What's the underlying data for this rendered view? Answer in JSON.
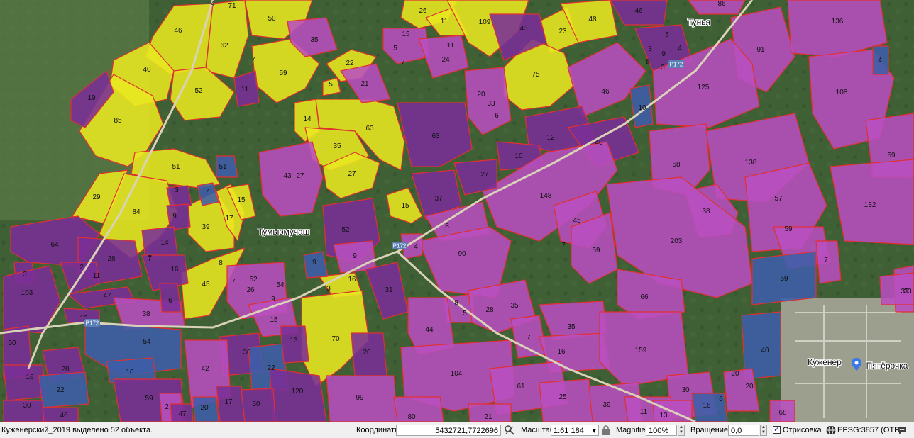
{
  "map": {
    "colors": {
      "background": "#3f5f35",
      "field_yellow": "#e8e820",
      "field_magenta": "#b84fc0",
      "field_purple": "#7a2f96",
      "field_blue": "#3d5fa8",
      "field_outline": "#e03030",
      "road": "#d9d2b8",
      "label": "#111111"
    },
    "place_labels": [
      {
        "id": "tunya",
        "text": "Тунья"
      },
      {
        "id": "tumyumuchash",
        "text": "Тумьюмучаш"
      },
      {
        "id": "kuzhener",
        "text": "Куженер"
      },
      {
        "id": "pyaterochka",
        "text": "Пятёрочка"
      }
    ],
    "road_labels": [
      {
        "id": "r172a",
        "text": "Р172"
      },
      {
        "id": "r172b",
        "text": "Р172"
      },
      {
        "id": "r172c",
        "text": "Р172"
      }
    ],
    "field_labels": [
      {
        "id": "y46",
        "text": "46",
        "color": "yellow"
      },
      {
        "id": "y71",
        "text": "71",
        "color": "yellow"
      },
      {
        "id": "y4a",
        "text": "4",
        "color": "yellow"
      },
      {
        "id": "y50",
        "text": "50",
        "color": "yellow"
      },
      {
        "id": "y62",
        "text": "62",
        "color": "yellow"
      },
      {
        "id": "y40",
        "text": "40",
        "color": "yellow"
      },
      {
        "id": "y52",
        "text": "52",
        "color": "yellow"
      },
      {
        "id": "y59a",
        "text": "59",
        "color": "yellow"
      },
      {
        "id": "y7a",
        "text": "7",
        "color": "yellow"
      },
      {
        "id": "y85",
        "text": "85",
        "color": "yellow"
      },
      {
        "id": "y51a",
        "text": "51",
        "color": "yellow"
      },
      {
        "id": "y29",
        "text": "29",
        "color": "yellow"
      },
      {
        "id": "y84",
        "text": "84",
        "color": "yellow"
      },
      {
        "id": "y39",
        "text": "39",
        "color": "yellow"
      },
      {
        "id": "y17",
        "text": "17",
        "color": "yellow"
      },
      {
        "id": "y15a",
        "text": "15",
        "color": "yellow"
      },
      {
        "id": "y45",
        "text": "45",
        "color": "yellow"
      },
      {
        "id": "y22a",
        "text": "22",
        "color": "yellow"
      },
      {
        "id": "y5a",
        "text": "5",
        "color": "yellow"
      },
      {
        "id": "y14a",
        "text": "14",
        "color": "yellow"
      },
      {
        "id": "y63a",
        "text": "63",
        "color": "yellow"
      },
      {
        "id": "y35a",
        "text": "35",
        "color": "yellow"
      },
      {
        "id": "y27a",
        "text": "27",
        "color": "yellow"
      },
      {
        "id": "y15b",
        "text": "15",
        "color": "yellow"
      },
      {
        "id": "y16a",
        "text": "16",
        "color": "yellow"
      },
      {
        "id": "y70",
        "text": "70",
        "color": "yellow"
      },
      {
        "id": "y3a",
        "text": "3",
        "color": "yellow"
      },
      {
        "id": "y26a",
        "text": "26",
        "color": "yellow"
      },
      {
        "id": "y11a",
        "text": "11",
        "color": "yellow"
      },
      {
        "id": "y109",
        "text": "109",
        "color": "yellow"
      },
      {
        "id": "y23",
        "text": "23",
        "color": "yellow"
      },
      {
        "id": "y48",
        "text": "48",
        "color": "yellow"
      },
      {
        "id": "y75",
        "text": "75",
        "color": "yellow"
      },
      {
        "id": "p35a",
        "text": "35",
        "color": "magenta"
      },
      {
        "id": "p11a",
        "text": "11",
        "color": "purple"
      },
      {
        "id": "p19",
        "text": "19",
        "color": "purple"
      },
      {
        "id": "p21",
        "text": "21",
        "color": "magenta"
      },
      {
        "id": "p15c",
        "text": "15",
        "color": "magenta"
      },
      {
        "id": "p5b",
        "text": "5",
        "color": "magenta"
      },
      {
        "id": "p7b",
        "text": "7",
        "color": "magenta"
      },
      {
        "id": "p11b",
        "text": "11",
        "color": "magenta"
      },
      {
        "id": "p24",
        "text": "24",
        "color": "magenta"
      },
      {
        "id": "p43a",
        "text": "43",
        "color": "purple"
      },
      {
        "id": "p20a",
        "text": "20",
        "color": "magenta"
      },
      {
        "id": "p33a",
        "text": "33",
        "color": "magenta"
      },
      {
        "id": "p6a",
        "text": "6",
        "color": "magenta"
      },
      {
        "id": "p63b",
        "text": "63",
        "color": "purple"
      },
      {
        "id": "p46a",
        "text": "46",
        "color": "purple"
      },
      {
        "id": "p46b",
        "text": "46",
        "color": "magenta"
      },
      {
        "id": "p86",
        "text": "86",
        "color": "magenta"
      },
      {
        "id": "p5c",
        "text": "5",
        "color": "purple"
      },
      {
        "id": "p3b",
        "text": "3",
        "color": "purple"
      },
      {
        "id": "p9a",
        "text": "9",
        "color": "purple"
      },
      {
        "id": "p4b",
        "text": "4",
        "color": "purple"
      },
      {
        "id": "p8a",
        "text": "8",
        "color": "purple"
      },
      {
        "id": "p3c",
        "text": "3",
        "color": "purple"
      },
      {
        "id": "p91",
        "text": "91",
        "color": "magenta"
      },
      {
        "id": "p136",
        "text": "136",
        "color": "magenta"
      },
      {
        "id": "p125",
        "text": "125",
        "color": "magenta"
      },
      {
        "id": "p108",
        "text": "108",
        "color": "magenta"
      },
      {
        "id": "b4a",
        "text": "4",
        "color": "blue"
      },
      {
        "id": "b10a",
        "text": "10",
        "color": "blue"
      },
      {
        "id": "p12",
        "text": "12",
        "color": "purple"
      },
      {
        "id": "p10b",
        "text": "10",
        "color": "purple"
      },
      {
        "id": "p40a",
        "text": "40",
        "color": "purple"
      },
      {
        "id": "p58",
        "text": "58",
        "color": "magenta"
      },
      {
        "id": "p138",
        "text": "138",
        "color": "magenta"
      },
      {
        "id": "p59b",
        "text": "59",
        "color": "magenta"
      },
      {
        "id": "p148",
        "text": "148",
        "color": "magenta"
      },
      {
        "id": "p57",
        "text": "57",
        "color": "magenta"
      },
      {
        "id": "p38a",
        "text": "38",
        "color": "magenta"
      },
      {
        "id": "p132",
        "text": "132",
        "color": "magenta"
      },
      {
        "id": "p59c",
        "text": "59",
        "color": "magenta"
      },
      {
        "id": "p203",
        "text": "203",
        "color": "magenta"
      },
      {
        "id": "p45b",
        "text": "45",
        "color": "magenta"
      },
      {
        "id": "p7c",
        "text": "7",
        "color": "magenta"
      },
      {
        "id": "p59d",
        "text": "59",
        "color": "magenta"
      },
      {
        "id": "b59e",
        "text": "59",
        "color": "blue"
      },
      {
        "id": "p7d",
        "text": "7",
        "color": "magenta"
      },
      {
        "id": "p33b",
        "text": "33",
        "color": "magenta"
      },
      {
        "id": "p43b",
        "text": "43",
        "color": "magenta"
      },
      {
        "id": "p27b",
        "text": "27",
        "color": "magenta"
      },
      {
        "id": "b51b",
        "text": "51",
        "color": "blue"
      },
      {
        "id": "b7e",
        "text": "7",
        "color": "blue"
      },
      {
        "id": "p3d",
        "text": "3",
        "color": "purple"
      },
      {
        "id": "p9b",
        "text": "9",
        "color": "purple"
      },
      {
        "id": "p14b",
        "text": "14",
        "color": "purple"
      },
      {
        "id": "p7f",
        "text": "7",
        "color": "purple"
      },
      {
        "id": "p37",
        "text": "37",
        "color": "purple"
      },
      {
        "id": "p27c",
        "text": "27",
        "color": "purple"
      },
      {
        "id": "p8b",
        "text": "8",
        "color": "magenta"
      },
      {
        "id": "p52b",
        "text": "52",
        "color": "purple"
      },
      {
        "id": "p90",
        "text": "90",
        "color": "magenta"
      },
      {
        "id": "p4c",
        "text": "4",
        "color": "magenta"
      },
      {
        "id": "p64",
        "text": "64",
        "color": "purple"
      },
      {
        "id": "p28a",
        "text": "28",
        "color": "purple"
      },
      {
        "id": "p3e",
        "text": "3",
        "color": "purple"
      },
      {
        "id": "p103",
        "text": "103",
        "color": "purple"
      },
      {
        "id": "p2a",
        "text": "2",
        "color": "purple"
      },
      {
        "id": "p11c",
        "text": "11",
        "color": "purple"
      },
      {
        "id": "p7g",
        "text": "7",
        "color": "purple"
      },
      {
        "id": "p16b",
        "text": "16",
        "color": "purple"
      },
      {
        "id": "p47",
        "text": "47",
        "color": "purple"
      },
      {
        "id": "p38b",
        "text": "38",
        "color": "magenta"
      },
      {
        "id": "p6b",
        "text": "6",
        "color": "purple"
      },
      {
        "id": "p13a",
        "text": "13",
        "color": "purple"
      },
      {
        "id": "p8c",
        "text": "8",
        "color": "purple"
      },
      {
        "id": "p7h",
        "text": "7",
        "color": "purple"
      },
      {
        "id": "p26b",
        "text": "26",
        "color": "magenta"
      },
      {
        "id": "p52c",
        "text": "52",
        "color": "magenta"
      },
      {
        "id": "p54a",
        "text": "54",
        "color": "magenta"
      },
      {
        "id": "p9c",
        "text": "9",
        "color": "magenta"
      },
      {
        "id": "p15d",
        "text": "15",
        "color": "magenta"
      },
      {
        "id": "b9d",
        "text": "9",
        "color": "blue"
      },
      {
        "id": "p9e",
        "text": "9",
        "color": "magenta"
      },
      {
        "id": "p31",
        "text": "31",
        "color": "purple"
      },
      {
        "id": "p8d",
        "text": "8",
        "color": "magenta"
      },
      {
        "id": "p5d",
        "text": "5",
        "color": "magenta"
      },
      {
        "id": "p28b",
        "text": "28",
        "color": "magenta"
      },
      {
        "id": "p35c",
        "text": "35",
        "color": "magenta"
      },
      {
        "id": "p66",
        "text": "66",
        "color": "magenta"
      },
      {
        "id": "p35d",
        "text": "35",
        "color": "magenta"
      },
      {
        "id": "p7i",
        "text": "7",
        "color": "magenta"
      },
      {
        "id": "p16c",
        "text": "16",
        "color": "magenta"
      },
      {
        "id": "p44",
        "text": "44",
        "color": "magenta"
      },
      {
        "id": "p159",
        "text": "159",
        "color": "magenta"
      },
      {
        "id": "b40b",
        "text": "40",
        "color": "blue"
      },
      {
        "id": "p50a",
        "text": "50",
        "color": "purple"
      },
      {
        "id": "b54b",
        "text": "54",
        "color": "blue"
      },
      {
        "id": "p30a",
        "text": "30",
        "color": "purple"
      },
      {
        "id": "b22b",
        "text": "22",
        "color": "blue"
      },
      {
        "id": "p13b",
        "text": "13",
        "color": "purple"
      },
      {
        "id": "p20b",
        "text": "20",
        "color": "purple"
      },
      {
        "id": "p104",
        "text": "104",
        "color": "magenta"
      },
      {
        "id": "p61",
        "text": "61",
        "color": "magenta"
      },
      {
        "id": "p28c",
        "text": "28",
        "color": "purple"
      },
      {
        "id": "p16d",
        "text": "16",
        "color": "purple"
      },
      {
        "id": "b10c",
        "text": "10",
        "color": "blue"
      },
      {
        "id": "p42",
        "text": "42",
        "color": "magenta"
      },
      {
        "id": "b22c",
        "text": "22",
        "color": "blue"
      },
      {
        "id": "p59f",
        "text": "59",
        "color": "purple"
      },
      {
        "id": "p120",
        "text": "120",
        "color": "purple"
      },
      {
        "id": "p99",
        "text": "99",
        "color": "magenta"
      },
      {
        "id": "p25",
        "text": "25",
        "color": "magenta"
      },
      {
        "id": "p39b",
        "text": "39",
        "color": "magenta"
      },
      {
        "id": "p30b",
        "text": "30",
        "color": "magenta"
      },
      {
        "id": "p20c",
        "text": "20",
        "color": "magenta"
      },
      {
        "id": "p20d",
        "text": "20",
        "color": "magenta"
      },
      {
        "id": "b16e",
        "text": "16",
        "color": "blue"
      },
      {
        "id": "p6c",
        "text": "6",
        "color": "magenta"
      },
      {
        "id": "p68",
        "text": "68",
        "color": "magenta"
      },
      {
        "id": "p30c",
        "text": "30",
        "color": "purple"
      },
      {
        "id": "p46c",
        "text": "46",
        "color": "purple"
      },
      {
        "id": "p2b",
        "text": "2",
        "color": "magenta"
      },
      {
        "id": "p47b",
        "text": "47",
        "color": "purple"
      },
      {
        "id": "b20e",
        "text": "20",
        "color": "blue"
      },
      {
        "id": "p17",
        "text": "17",
        "color": "purple"
      },
      {
        "id": "p50b",
        "text": "50",
        "color": "purple"
      },
      {
        "id": "p80",
        "text": "80",
        "color": "magenta"
      },
      {
        "id": "p21b",
        "text": "21",
        "color": "magenta"
      },
      {
        "id": "p11d",
        "text": "11",
        "color": "magenta"
      },
      {
        "id": "p13c",
        "text": "13",
        "color": "magenta"
      },
      {
        "id": "p33c",
        "text": "33",
        "color": "magenta"
      }
    ]
  },
  "status_bar": {
    "selection_message": "Куженерский_2019 выделено 52 объекта.",
    "coords_label": "Координаты",
    "coords_value": "5432721,7722696",
    "scale_label": "Масштаб",
    "scale_value": "1:61 184",
    "magnifier_label": "Magnifier",
    "magnifier_value": "100%",
    "rotation_label": "Вращение",
    "rotation_value": "0,0",
    "render_label": "Отрисовка",
    "render_checked": true,
    "crs_label": "EPSG:3857 (OTF)"
  }
}
